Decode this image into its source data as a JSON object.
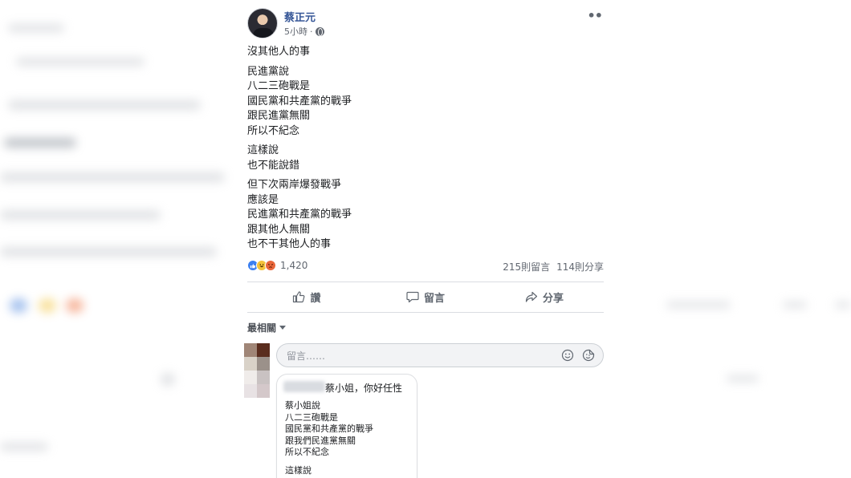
{
  "post": {
    "author": "蔡正元",
    "time": "5小時",
    "time_sep": "·",
    "more_label": "••",
    "paragraphs": [
      [
        "沒其他人的事"
      ],
      [
        "民進黨說",
        "八二三砲戰是",
        "國民黨和共產黨的戰爭",
        "跟民進黨無關",
        "所以不紀念"
      ],
      [
        "這樣說",
        "也不能說錯"
      ],
      [
        "但下次兩岸爆發戰爭",
        "應該是",
        "民進黨和共產黨的戰爭",
        "跟其他人無關",
        "也不干其他人的事"
      ]
    ]
  },
  "stats": {
    "reaction_count": "1,420",
    "comments": "215則留言",
    "shares": "114則分享",
    "reactions": [
      "like-icon",
      "haha-icon",
      "angry-icon"
    ]
  },
  "actions": {
    "like_label": "讚",
    "comment_label": "留言",
    "share_label": "分享"
  },
  "comments": {
    "sort_label": "最相關",
    "placeholder": "留言……",
    "reply": {
      "head": "蔡小姐，你好任性",
      "lines": [
        "蔡小姐說",
        "八二三砲戰是",
        "國民黨和共產黨的戰爭",
        "跟我們民進黨無關",
        "所以不紀念"
      ],
      "lines2": [
        "這樣說"
      ]
    }
  },
  "colors": {
    "author_blue": "#385898",
    "like_blue": "#3b7ff0",
    "muted": "#616770"
  }
}
